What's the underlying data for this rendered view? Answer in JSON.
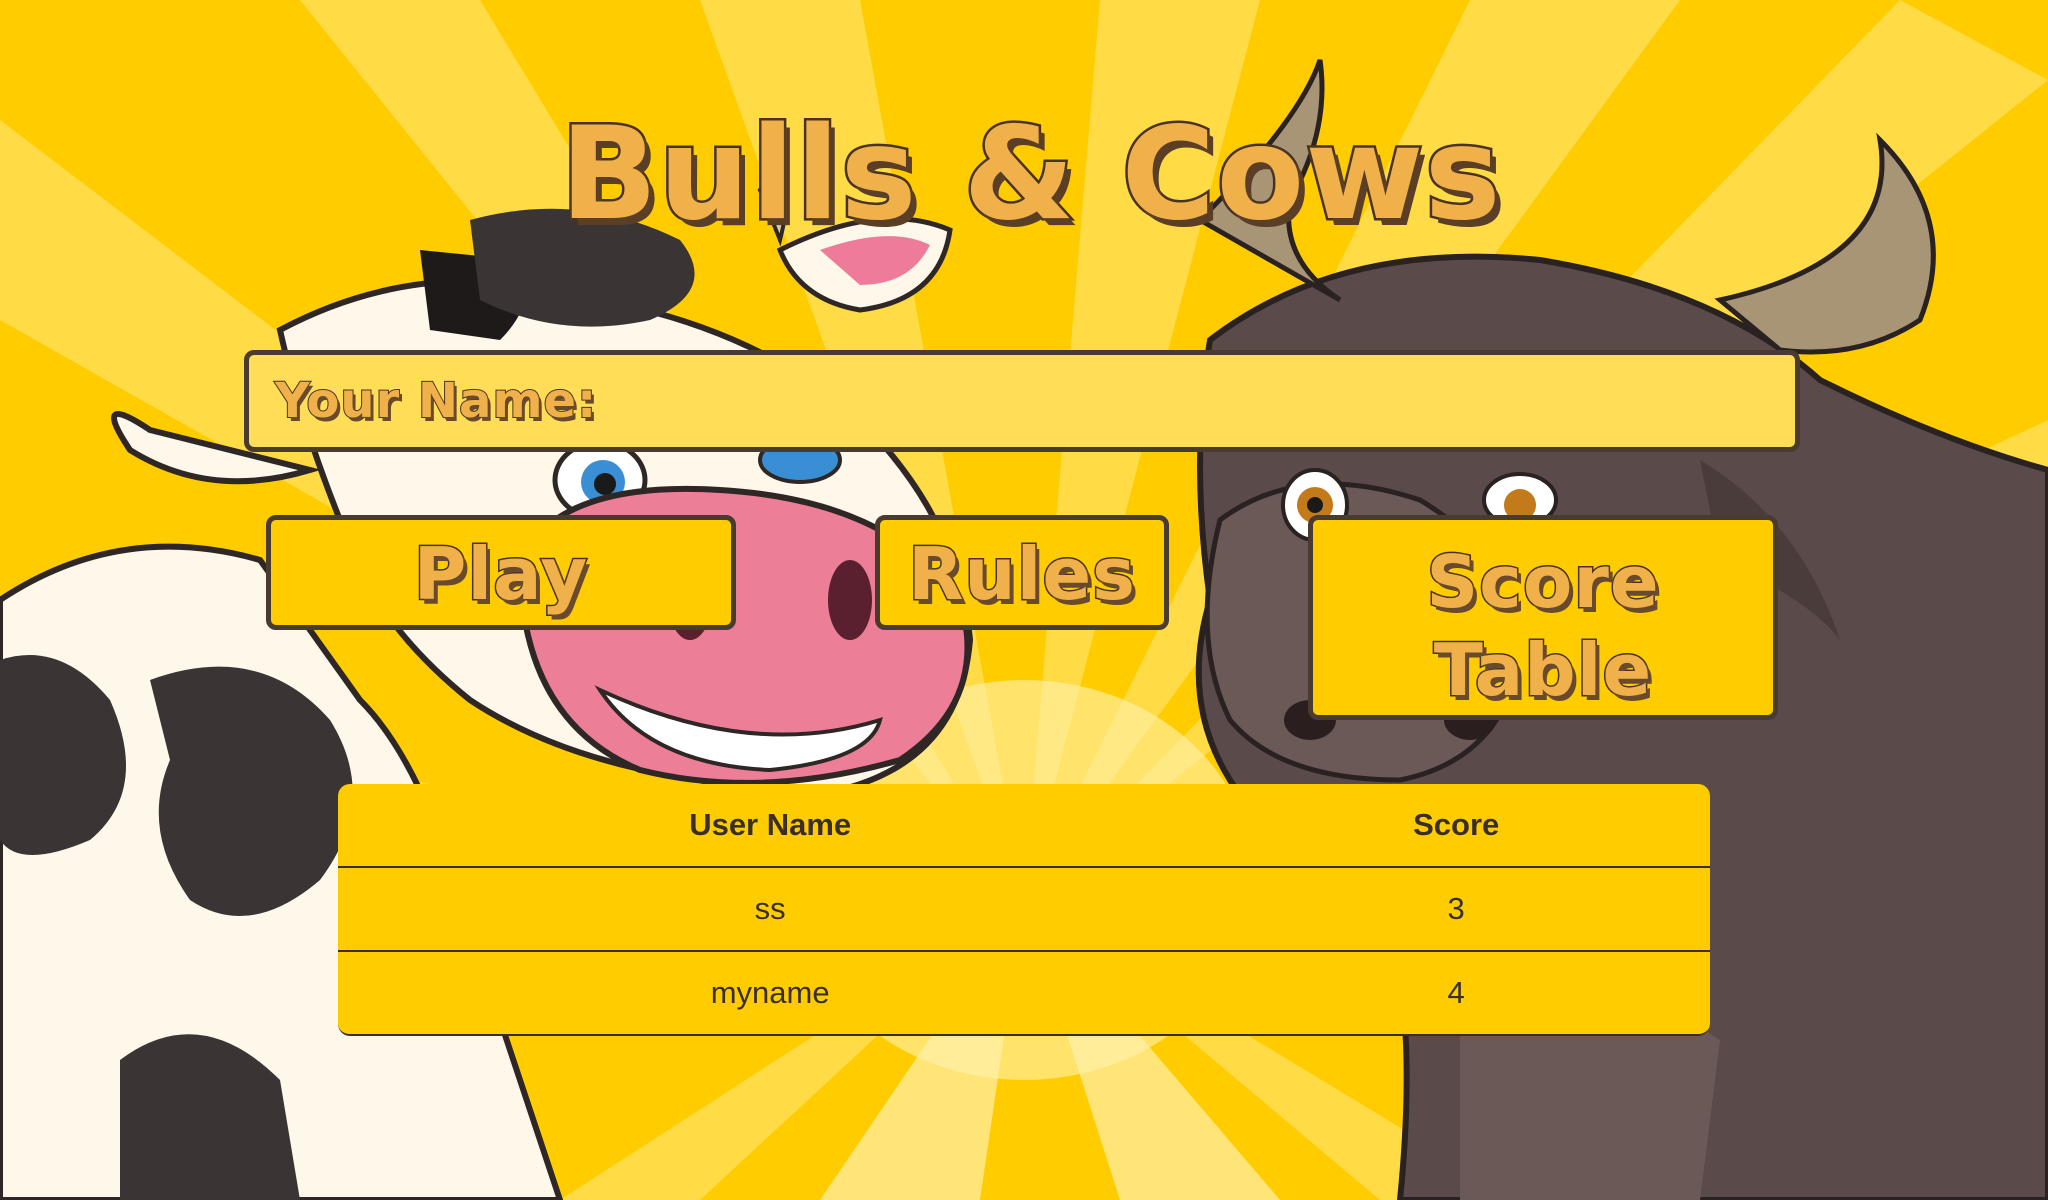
{
  "title": "Bulls & Cows",
  "name_field": {
    "label": "Your Name:",
    "value": ""
  },
  "buttons": {
    "play": "Play",
    "rules": "Rules",
    "score_line1": "Score",
    "score_line2": "Table"
  },
  "score_table": {
    "headers": {
      "user": "User Name",
      "score": "Score"
    },
    "rows": [
      {
        "user": "ss",
        "score": "3"
      },
      {
        "user": "myname",
        "score": "4"
      }
    ]
  },
  "colors": {
    "background": "#ffcc00",
    "panel": "#ffcc00",
    "input_bg": "#ffdd57",
    "title_fill": "#f0b04a",
    "outline": "#4a3326",
    "cow_spots": "#3a3434",
    "cow_body": "#fdf8ea",
    "cow_nose": "#e9748a",
    "bull_body": "#5a4a49"
  }
}
